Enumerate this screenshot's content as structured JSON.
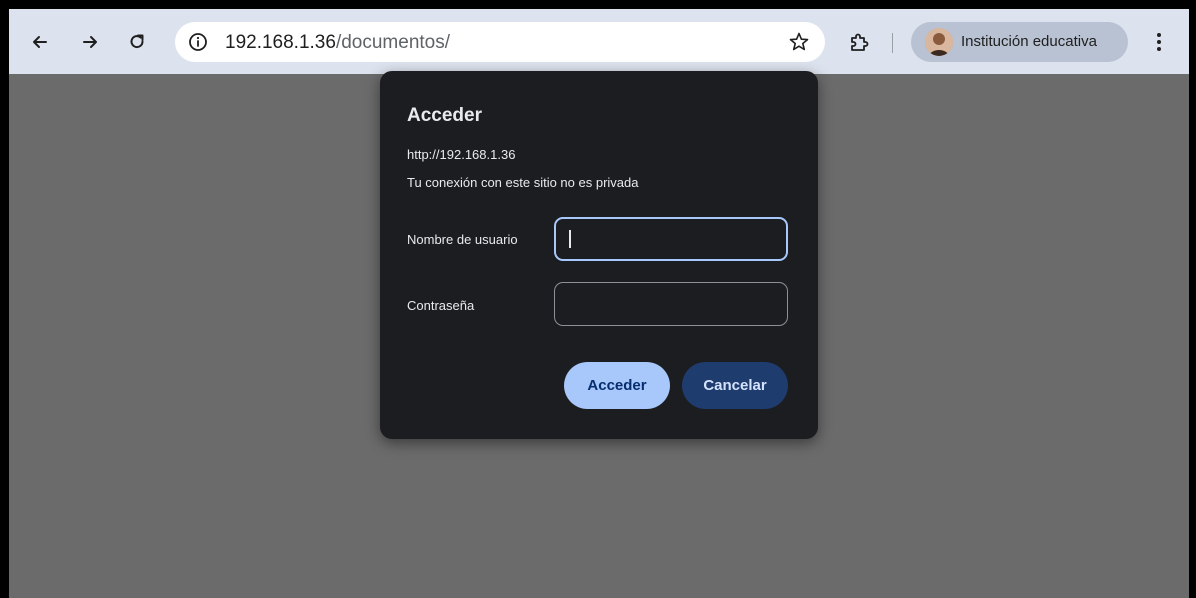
{
  "browser": {
    "url_host": "192.168.1.36",
    "url_path": "/documentos/",
    "profile_name": "Institución educativa"
  },
  "dialog": {
    "title": "Acceder",
    "origin": "http://192.168.1.36",
    "warning": "Tu conexión con este sitio no es privada",
    "username_label": "Nombre de usuario",
    "username_value": "",
    "password_label": "Contraseña",
    "password_value": "",
    "submit_label": "Acceder",
    "cancel_label": "Cancelar"
  },
  "colors": {
    "page_background": "#6b6b6b",
    "dialog_background": "#1c1d21",
    "primary_button": "#a8c7fa",
    "secondary_button": "#1f3c6e",
    "focus_ring": "#a8c7fa"
  }
}
